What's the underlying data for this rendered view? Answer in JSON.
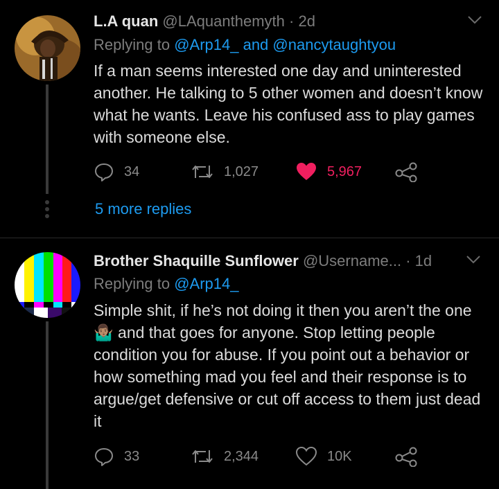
{
  "tweets": [
    {
      "display_name": "L.A quan",
      "handle": "@LAquanthemyth",
      "sep": "·",
      "time": "2d",
      "replying_prefix": "Replying to",
      "replying_to": "@Arp14_ and @nancytaughtyou",
      "text": "If a man seems interested one day and uninterested another. He talking to 5 other women and doesn’t know what he wants. Leave his confused ass to play games with someone else.",
      "replies": "34",
      "retweets": "1,027",
      "likes": "5,967",
      "liked": true,
      "more_replies": "5 more replies"
    },
    {
      "display_name": "Brother Shaquille Sunflower",
      "handle": "@Username...",
      "sep": "·",
      "time": "1d",
      "replying_prefix": "Replying to",
      "replying_to": "@Arp14_",
      "text_part1": "Simple shit, if he’s not doing it then you aren’t the one",
      "emoji": "🤷🏽‍♂️",
      "text_part2": " and that goes for anyone. Stop letting people condition you for abuse. If you point out a behavior or how something mad you feel and their response is to argue/get defensive or cut off access to them just dead it",
      "replies": "33",
      "retweets": "2,344",
      "likes": "10K",
      "liked": false
    }
  ],
  "colors": {
    "link": "#1d9bf0",
    "like": "#f01f5f",
    "muted": "#7d7d7d"
  }
}
